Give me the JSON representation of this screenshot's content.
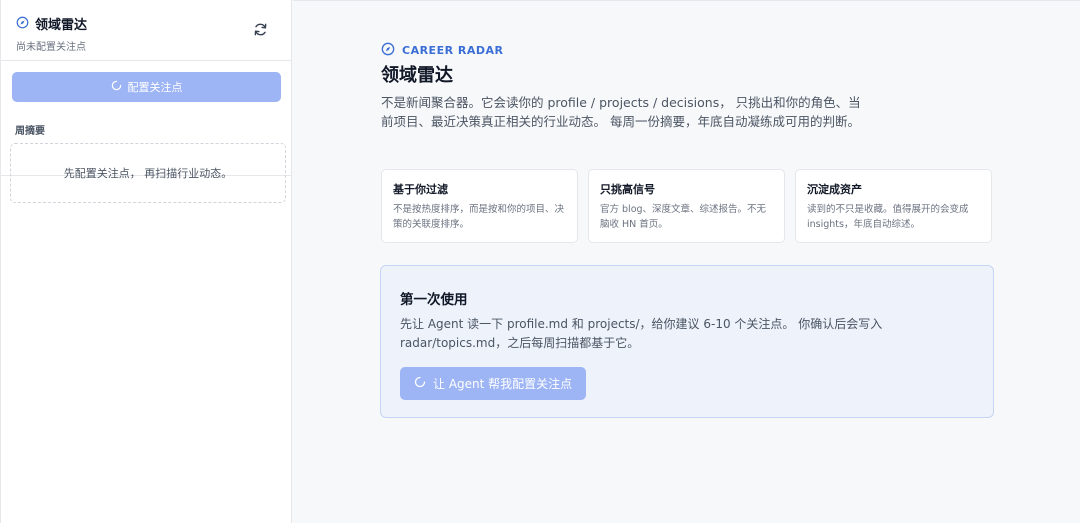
{
  "sidebar": {
    "title": "领域雷达",
    "subtitle": "尚未配置关注点",
    "config_button": "配置关注点",
    "section_label": "周摘要",
    "empty_text": "先配置关注点， 再扫描行业动态。"
  },
  "main": {
    "brand": "CAREER RADAR",
    "title": "领域雷达",
    "description": "不是新闻聚合器。它会读你的 profile / projects / decisions， 只挑出和你的角色、当前项目、最近决策真正相关的行业动态。 每周一份摘要，年底自动凝练成可用的判断。",
    "cards": [
      {
        "title": "基于你过滤",
        "text": "不是按热度排序，而是按和你的项目、决策的关联度排序。"
      },
      {
        "title": "只挑高信号",
        "text": "官方 blog、深度文章、综述报告。不无脑收 HN 首页。"
      },
      {
        "title": "沉淀成资产",
        "text": "读到的不只是收藏。值得展开的会变成 insights，年底自动综述。"
      }
    ],
    "first_use": {
      "title": "第一次使用",
      "text": "先让 Agent 读一下 profile.md 和 projects/，给你建议 6-10 个关注点。 你确认后会写入 radar/topics.md，之后每周扫描都基于它。",
      "button": "让 Agent 帮我配置关注点"
    }
  },
  "colors": {
    "accent": "#3b6fd6",
    "button_bg": "#9db4f5",
    "panel_bg": "#eef2fb"
  }
}
